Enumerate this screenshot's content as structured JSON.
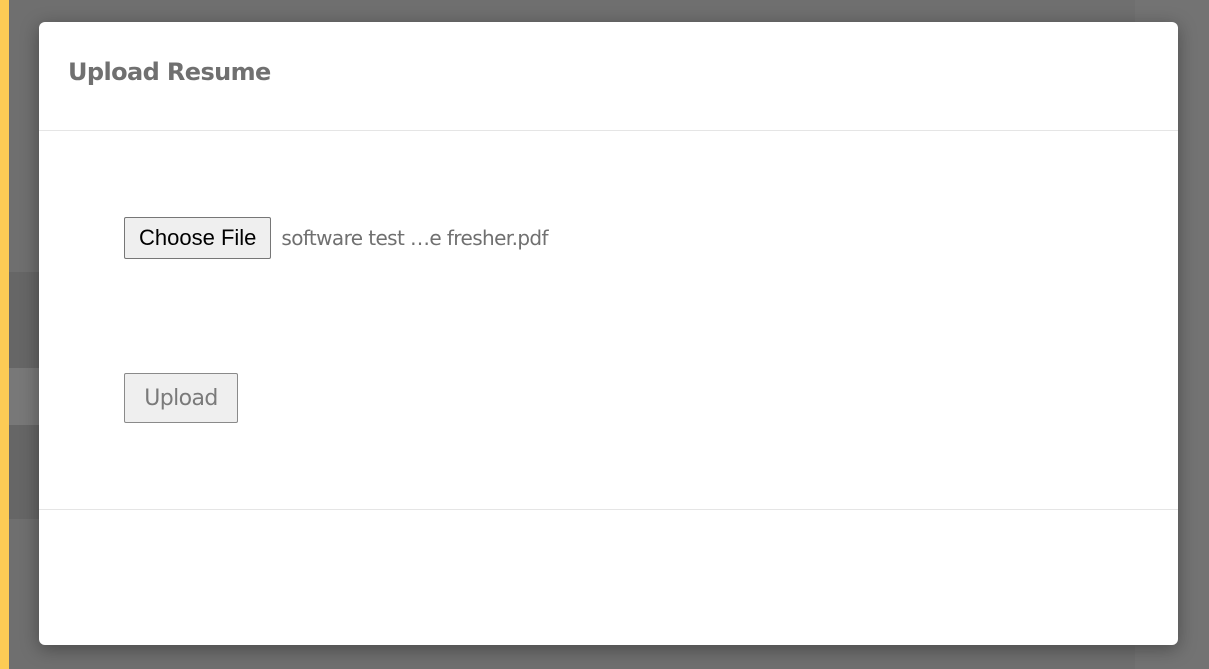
{
  "modal": {
    "title": "Upload Resume",
    "file_input": {
      "button_label": "Choose File",
      "selected_file": "software test …e fresher.pdf"
    },
    "upload_button_label": "Upload",
    "upload_button_state": "disabled"
  },
  "colors": {
    "page_border": "#fccb55",
    "backdrop": "#6f6f6f",
    "modal_background": "#ffffff",
    "title_text": "#707070",
    "divider": "#e5e5e5",
    "button_background": "#efefef"
  }
}
